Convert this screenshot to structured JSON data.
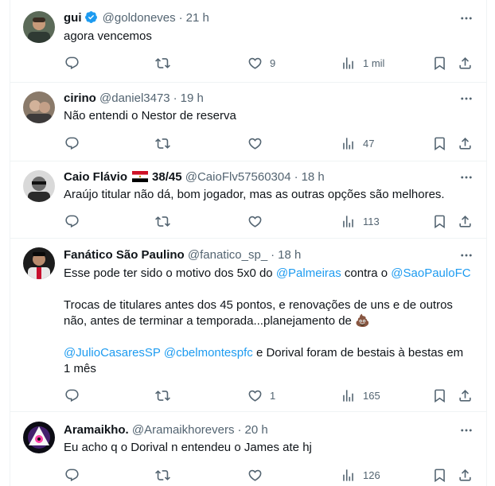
{
  "tweets": [
    {
      "name": "gui",
      "verified": true,
      "handle": "@goldoneves",
      "time": "21 h",
      "lines": [
        "agora vencemos"
      ],
      "replies": "",
      "retweets": "",
      "likes": "9",
      "views": "1 mil"
    },
    {
      "name": "cirino",
      "handle": "@daniel3473",
      "time": "19 h",
      "lines": [
        "Não entendi o Nestor de reserva"
      ],
      "replies": "",
      "retweets": "",
      "likes": "",
      "views": "47"
    },
    {
      "name": "Caio Flávio",
      "name_suffix": "38/45",
      "handle": "@CaioFlv57560304",
      "time": "18 h",
      "lines": [
        "Araújo titular não dá, bom jogador, mas as outras opções são melhores."
      ],
      "replies": "",
      "retweets": "",
      "likes": "",
      "views": "113"
    },
    {
      "name": "Fanático São Paulino",
      "handle": "@fanatico_sp_",
      "time": "18 h",
      "line1_pre": "Esse pode ter sido o motivo dos 5x0 do ",
      "line1_link1": "@Palmeiras",
      "line1_mid": " contra o ",
      "line1_link2": "@SaoPauloFC",
      "line3": "Trocas de titulares antes dos 45 pontos, e renovações de uns e de outros",
      "line4": "não, antes de terminar a temporada...planejamento de 💩",
      "line6_link1": "@JulioCasaresSP",
      "line6_link2": "@cbelmontespfc",
      "line6_post": " e Dorival foram de bestais à bestas em",
      "line7": "1 mês",
      "replies": "",
      "retweets": "",
      "likes": "1",
      "views": "165"
    },
    {
      "name": "Aramaikho.",
      "handle": "@Aramaikhorevers",
      "time": "20 h",
      "lines": [
        "Eu acho q o Dorival n entendeu o James ate hj"
      ],
      "replies": "",
      "retweets": "",
      "likes": "",
      "views": "126"
    }
  ],
  "colors": {
    "accent": "#1d9bf0",
    "secondary_text": "#536471",
    "primary_text": "#0f1419"
  },
  "icons": [
    "reply-icon",
    "retweet-icon",
    "like-icon",
    "views-icon",
    "bookmark-icon",
    "share-icon",
    "more-icon",
    "verified-badge-icon",
    "flag-icon"
  ]
}
